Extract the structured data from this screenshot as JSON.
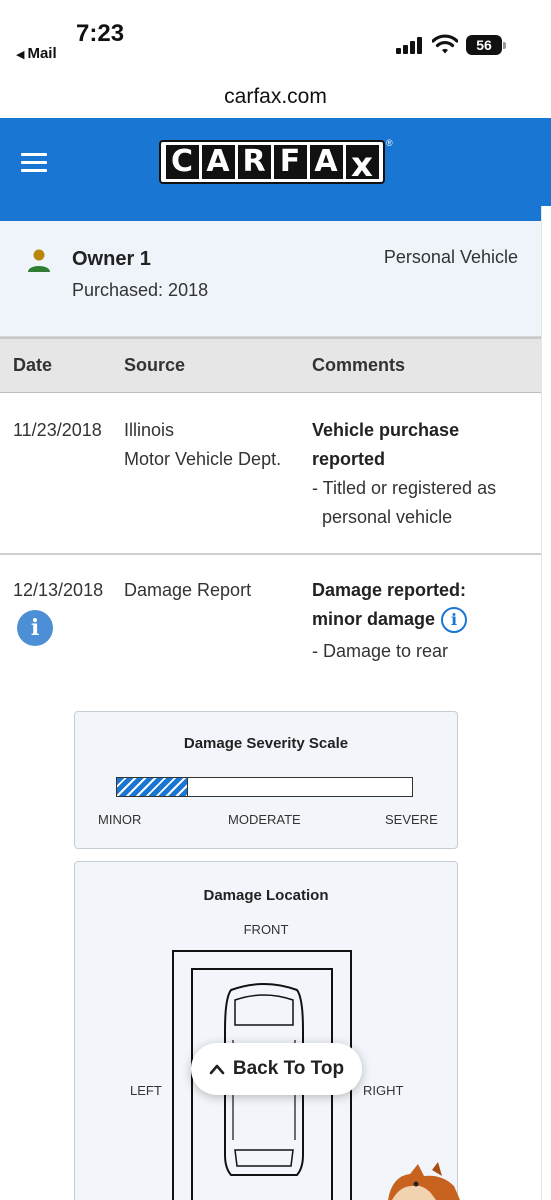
{
  "status_bar": {
    "time": "7:23",
    "back_app": "Mail",
    "battery": "56"
  },
  "browser": {
    "url": "carfax.com"
  },
  "header": {
    "logo_letters": [
      "C",
      "A",
      "R",
      "F",
      "A",
      "X"
    ],
    "logo_registered": "®",
    "accent_color": "#1976d2"
  },
  "owner": {
    "name": "Owner 1",
    "purchased": "Purchased: 2018",
    "vehicle_type": "Personal Vehicle"
  },
  "table": {
    "headers": {
      "date": "Date",
      "source": "Source",
      "comments": "Comments"
    },
    "rows": [
      {
        "date": "11/23/2018",
        "source_line1": "Illinois",
        "source_line2": "Motor Vehicle Dept.",
        "comment_title_line1": "Vehicle purchase",
        "comment_title_line2": "reported",
        "comment_detail_line1": "- Titled or registered as",
        "comment_detail_line2": "personal vehicle"
      },
      {
        "date": "12/13/2018",
        "source_line1": "Damage Report",
        "comment_title_line1": "Damage reported:",
        "comment_title_line2": "minor damage",
        "comment_detail_line1": "- Damage to rear"
      }
    ]
  },
  "severity": {
    "title": "Damage Severity Scale",
    "level_fraction": 0.24,
    "labels": {
      "minor": "MINOR",
      "moderate": "MODERATE",
      "severe": "SEVERE"
    }
  },
  "location": {
    "title": "Damage Location",
    "front": "FRONT",
    "left": "LEFT",
    "right": "RIGHT"
  },
  "back_to_top": {
    "label": "Back To Top"
  }
}
